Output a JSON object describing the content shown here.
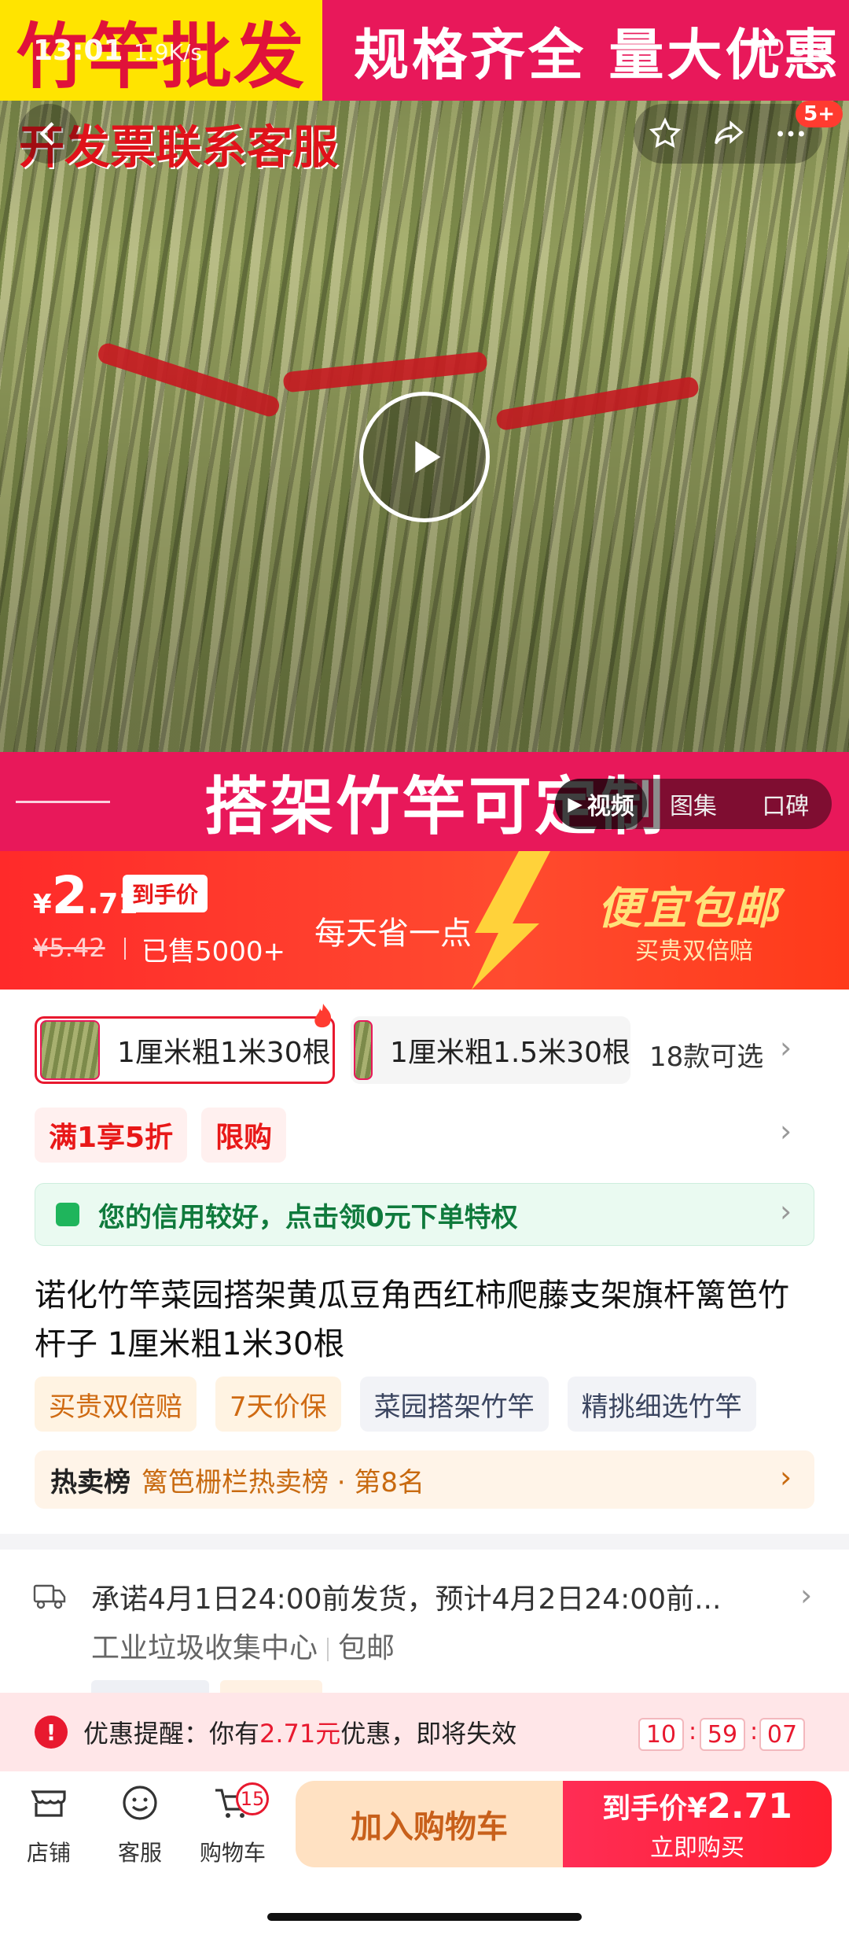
{
  "status": {
    "time": "13:01",
    "speed": "1.9K/s",
    "right": "HD 5G"
  },
  "hero": {
    "banner_left": "竹竿批发",
    "banner_right": "规格齐全 量大优惠",
    "subtitle": "开发票联系客服",
    "bottom_text": "搭架竹竿可定制",
    "notif_badge": "5+",
    "media_tabs": [
      "视频",
      "图集",
      "口碑"
    ]
  },
  "price": {
    "currency": "¥",
    "int": "2",
    "dec": ".71",
    "tag": "到手价",
    "old": "¥5.42",
    "sold": "已售5000+",
    "save": "每天省一点",
    "promo_title": "便宜包邮",
    "promo_sub": "买贵双倍赔"
  },
  "skus": {
    "items": [
      "1厘米粗1米30根",
      "1厘米粗1.5米30根"
    ],
    "more": "18款可选"
  },
  "chips": [
    "满1享5折",
    "限购"
  ],
  "credit": {
    "text": "您的信用较好，点击领0元下单特权"
  },
  "title": "诺化竹竿菜园搭架黄瓜豆角西红柿爬藤支架旗杆篱笆竹杆子 1厘米粗1米30根",
  "tags": [
    "买贵双倍赔",
    "7天价保",
    "菜园搭架竹竿",
    "精挑细选竹竿"
  ],
  "hot": {
    "key": "热卖榜",
    "value": "篱笆栅栏热卖榜 · 第8名"
  },
  "ship": {
    "line1": "承诺4月1日24:00前发货，预计4月2日24:00前...",
    "from": "工业垃圾收集中心",
    "free": "包邮"
  },
  "coupon": {
    "prefix": "优惠提醒：你有",
    "amount": "2.71元",
    "suffix": "优惠，即将失效",
    "h": "10",
    "m": "59",
    "s": "07"
  },
  "bottom": {
    "shop": "店铺",
    "service": "客服",
    "cart": "购物车",
    "cart_count": "15",
    "add_cart": "加入购物车",
    "buy_top": "到手价",
    "buy_cur": "¥",
    "buy_price": "2.71",
    "buy_bottom": "立即购买"
  },
  "colors": {
    "accent": "#e8192f",
    "banner_yellow": "#ffe400",
    "banner_pink": "#e8185a"
  }
}
